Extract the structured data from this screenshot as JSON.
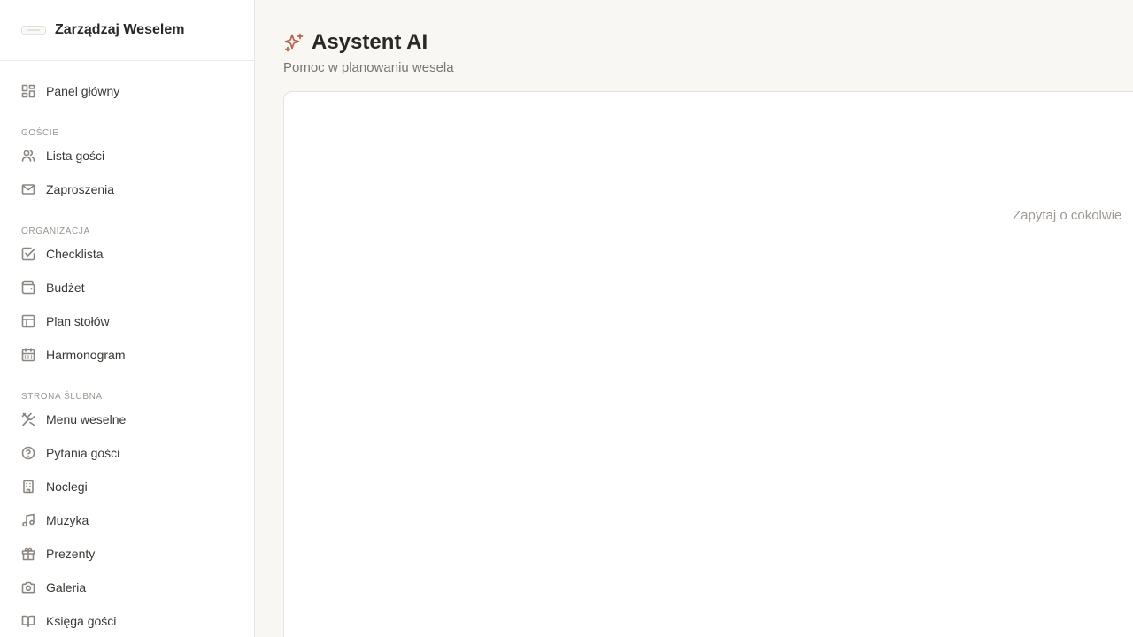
{
  "brand": {
    "name": "Zarządzaj Weselem"
  },
  "sidebar": {
    "top_items": [
      {
        "label": "Panel główny",
        "icon": "dashboard-icon"
      }
    ],
    "sections": [
      {
        "title": "GOŚCIE",
        "items": [
          {
            "label": "Lista gości",
            "icon": "users-icon"
          },
          {
            "label": "Zaproszenia",
            "icon": "mail-icon"
          }
        ]
      },
      {
        "title": "ORGANIZACJA",
        "items": [
          {
            "label": "Checklista",
            "icon": "check-square-icon"
          },
          {
            "label": "Budżet",
            "icon": "wallet-icon"
          },
          {
            "label": "Plan stołów",
            "icon": "table-layout-icon"
          },
          {
            "label": "Harmonogram",
            "icon": "calendar-icon"
          }
        ]
      },
      {
        "title": "STRONA ŚLUBNA",
        "items": [
          {
            "label": "Menu weselne",
            "icon": "utensils-icon"
          },
          {
            "label": "Pytania gości",
            "icon": "help-circle-icon"
          },
          {
            "label": "Noclegi",
            "icon": "building-icon"
          },
          {
            "label": "Muzyka",
            "icon": "music-icon"
          },
          {
            "label": "Prezenty",
            "icon": "gift-icon"
          },
          {
            "label": "Galeria",
            "icon": "camera-icon"
          },
          {
            "label": "Księga gości",
            "icon": "book-icon"
          }
        ]
      }
    ]
  },
  "header": {
    "title": "Asystent AI",
    "subtitle": "Pomoc w planowaniu wesela",
    "icon": "sparkles-icon",
    "accent_color": "#b9644a"
  },
  "chat": {
    "empty_prompt": "Zapytaj o cokolwie"
  }
}
